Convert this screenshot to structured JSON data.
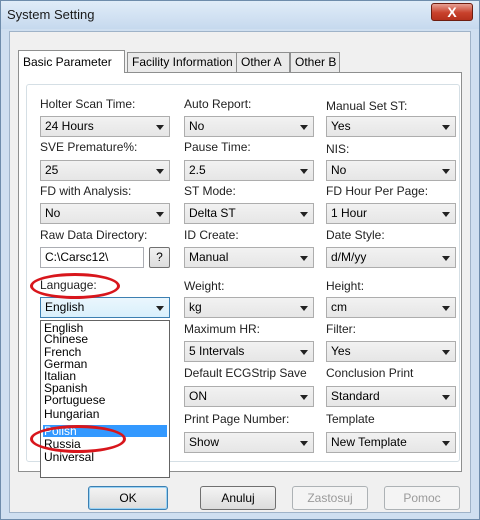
{
  "window": {
    "title": "System Setting",
    "close_glyph": "X"
  },
  "tabs": [
    "Basic Parameter",
    "Facility Information",
    "Other A",
    "Other B"
  ],
  "fields": {
    "holter_scan_time": {
      "label": "Holter Scan Time:",
      "value": "24  Hours"
    },
    "auto_report": {
      "label": "Auto Report:",
      "value": "No"
    },
    "manual_set_st": {
      "label": "Manual Set ST:",
      "value": "Yes"
    },
    "sve_premature": {
      "label": "SVE Premature%:",
      "value": "25"
    },
    "pause_time": {
      "label": "Pause Time:",
      "value": "2.5"
    },
    "nis": {
      "label": "NIS:",
      "value": "No"
    },
    "fd_with_analysis": {
      "label": "FD with Analysis:",
      "value": "No"
    },
    "st_mode": {
      "label": "ST Mode:",
      "value": "Delta ST"
    },
    "fd_hour_per_page": {
      "label": "FD Hour Per Page:",
      "value": "1 Hour"
    },
    "raw_data_directory": {
      "label": "Raw Data Directory:",
      "value": "C:\\Carsc12\\",
      "browse": "?"
    },
    "id_create": {
      "label": "ID Create:",
      "value": "Manual"
    },
    "date_style": {
      "label": "Date Style:",
      "value": "d/M/yy"
    },
    "language": {
      "label": "Language:",
      "value": "English"
    },
    "weight": {
      "label": "Weight:",
      "value": "kg"
    },
    "height": {
      "label": "Height:",
      "value": "cm"
    },
    "maximum_hr": {
      "label": "Maximum HR:",
      "value": "5 Intervals"
    },
    "filter": {
      "label": "Filter:",
      "value": "Yes"
    },
    "default_ecg_strip_save": {
      "label": "Default ECGStrip Save",
      "value": "ON"
    },
    "conclusion_print": {
      "label": "Conclusion Print",
      "value": "Standard"
    },
    "print_page_number": {
      "label": "Print Page Number:",
      "value": "Show"
    },
    "template": {
      "label": "Template",
      "value": "New Template"
    }
  },
  "language_options": [
    "English",
    "Chinese",
    "French",
    "German",
    "Italian",
    "Spanish",
    "Portuguese",
    "Hungarian",
    "Polish",
    "Russia",
    "Universal"
  ],
  "language_highlighted": "Polish",
  "buttons": {
    "ok": "OK",
    "cancel": "Anuluj",
    "apply": "Zastosuj",
    "help": "Pomoc"
  },
  "colors": {
    "annotation_circle": "#d8161c",
    "selection": "#3399ff"
  }
}
